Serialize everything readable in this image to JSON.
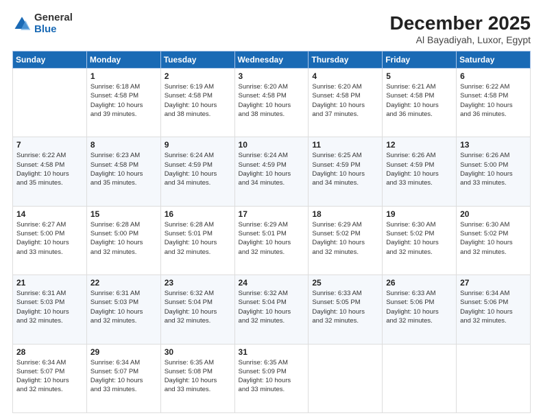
{
  "logo": {
    "general": "General",
    "blue": "Blue"
  },
  "title": "December 2025",
  "location": "Al Bayadiyah, Luxor, Egypt",
  "days_header": [
    "Sunday",
    "Monday",
    "Tuesday",
    "Wednesday",
    "Thursday",
    "Friday",
    "Saturday"
  ],
  "weeks": [
    [
      {
        "day": "",
        "info": ""
      },
      {
        "day": "1",
        "info": "Sunrise: 6:18 AM\nSunset: 4:58 PM\nDaylight: 10 hours\nand 39 minutes."
      },
      {
        "day": "2",
        "info": "Sunrise: 6:19 AM\nSunset: 4:58 PM\nDaylight: 10 hours\nand 38 minutes."
      },
      {
        "day": "3",
        "info": "Sunrise: 6:20 AM\nSunset: 4:58 PM\nDaylight: 10 hours\nand 38 minutes."
      },
      {
        "day": "4",
        "info": "Sunrise: 6:20 AM\nSunset: 4:58 PM\nDaylight: 10 hours\nand 37 minutes."
      },
      {
        "day": "5",
        "info": "Sunrise: 6:21 AM\nSunset: 4:58 PM\nDaylight: 10 hours\nand 36 minutes."
      },
      {
        "day": "6",
        "info": "Sunrise: 6:22 AM\nSunset: 4:58 PM\nDaylight: 10 hours\nand 36 minutes."
      }
    ],
    [
      {
        "day": "7",
        "info": "Sunrise: 6:22 AM\nSunset: 4:58 PM\nDaylight: 10 hours\nand 35 minutes."
      },
      {
        "day": "8",
        "info": "Sunrise: 6:23 AM\nSunset: 4:58 PM\nDaylight: 10 hours\nand 35 minutes."
      },
      {
        "day": "9",
        "info": "Sunrise: 6:24 AM\nSunset: 4:59 PM\nDaylight: 10 hours\nand 34 minutes."
      },
      {
        "day": "10",
        "info": "Sunrise: 6:24 AM\nSunset: 4:59 PM\nDaylight: 10 hours\nand 34 minutes."
      },
      {
        "day": "11",
        "info": "Sunrise: 6:25 AM\nSunset: 4:59 PM\nDaylight: 10 hours\nand 34 minutes."
      },
      {
        "day": "12",
        "info": "Sunrise: 6:26 AM\nSunset: 4:59 PM\nDaylight: 10 hours\nand 33 minutes."
      },
      {
        "day": "13",
        "info": "Sunrise: 6:26 AM\nSunset: 5:00 PM\nDaylight: 10 hours\nand 33 minutes."
      }
    ],
    [
      {
        "day": "14",
        "info": "Sunrise: 6:27 AM\nSunset: 5:00 PM\nDaylight: 10 hours\nand 33 minutes."
      },
      {
        "day": "15",
        "info": "Sunrise: 6:28 AM\nSunset: 5:00 PM\nDaylight: 10 hours\nand 32 minutes."
      },
      {
        "day": "16",
        "info": "Sunrise: 6:28 AM\nSunset: 5:01 PM\nDaylight: 10 hours\nand 32 minutes."
      },
      {
        "day": "17",
        "info": "Sunrise: 6:29 AM\nSunset: 5:01 PM\nDaylight: 10 hours\nand 32 minutes."
      },
      {
        "day": "18",
        "info": "Sunrise: 6:29 AM\nSunset: 5:02 PM\nDaylight: 10 hours\nand 32 minutes."
      },
      {
        "day": "19",
        "info": "Sunrise: 6:30 AM\nSunset: 5:02 PM\nDaylight: 10 hours\nand 32 minutes."
      },
      {
        "day": "20",
        "info": "Sunrise: 6:30 AM\nSunset: 5:02 PM\nDaylight: 10 hours\nand 32 minutes."
      }
    ],
    [
      {
        "day": "21",
        "info": "Sunrise: 6:31 AM\nSunset: 5:03 PM\nDaylight: 10 hours\nand 32 minutes."
      },
      {
        "day": "22",
        "info": "Sunrise: 6:31 AM\nSunset: 5:03 PM\nDaylight: 10 hours\nand 32 minutes."
      },
      {
        "day": "23",
        "info": "Sunrise: 6:32 AM\nSunset: 5:04 PM\nDaylight: 10 hours\nand 32 minutes."
      },
      {
        "day": "24",
        "info": "Sunrise: 6:32 AM\nSunset: 5:04 PM\nDaylight: 10 hours\nand 32 minutes."
      },
      {
        "day": "25",
        "info": "Sunrise: 6:33 AM\nSunset: 5:05 PM\nDaylight: 10 hours\nand 32 minutes."
      },
      {
        "day": "26",
        "info": "Sunrise: 6:33 AM\nSunset: 5:06 PM\nDaylight: 10 hours\nand 32 minutes."
      },
      {
        "day": "27",
        "info": "Sunrise: 6:34 AM\nSunset: 5:06 PM\nDaylight: 10 hours\nand 32 minutes."
      }
    ],
    [
      {
        "day": "28",
        "info": "Sunrise: 6:34 AM\nSunset: 5:07 PM\nDaylight: 10 hours\nand 32 minutes."
      },
      {
        "day": "29",
        "info": "Sunrise: 6:34 AM\nSunset: 5:07 PM\nDaylight: 10 hours\nand 33 minutes."
      },
      {
        "day": "30",
        "info": "Sunrise: 6:35 AM\nSunset: 5:08 PM\nDaylight: 10 hours\nand 33 minutes."
      },
      {
        "day": "31",
        "info": "Sunrise: 6:35 AM\nSunset: 5:09 PM\nDaylight: 10 hours\nand 33 minutes."
      },
      {
        "day": "",
        "info": ""
      },
      {
        "day": "",
        "info": ""
      },
      {
        "day": "",
        "info": ""
      }
    ]
  ]
}
